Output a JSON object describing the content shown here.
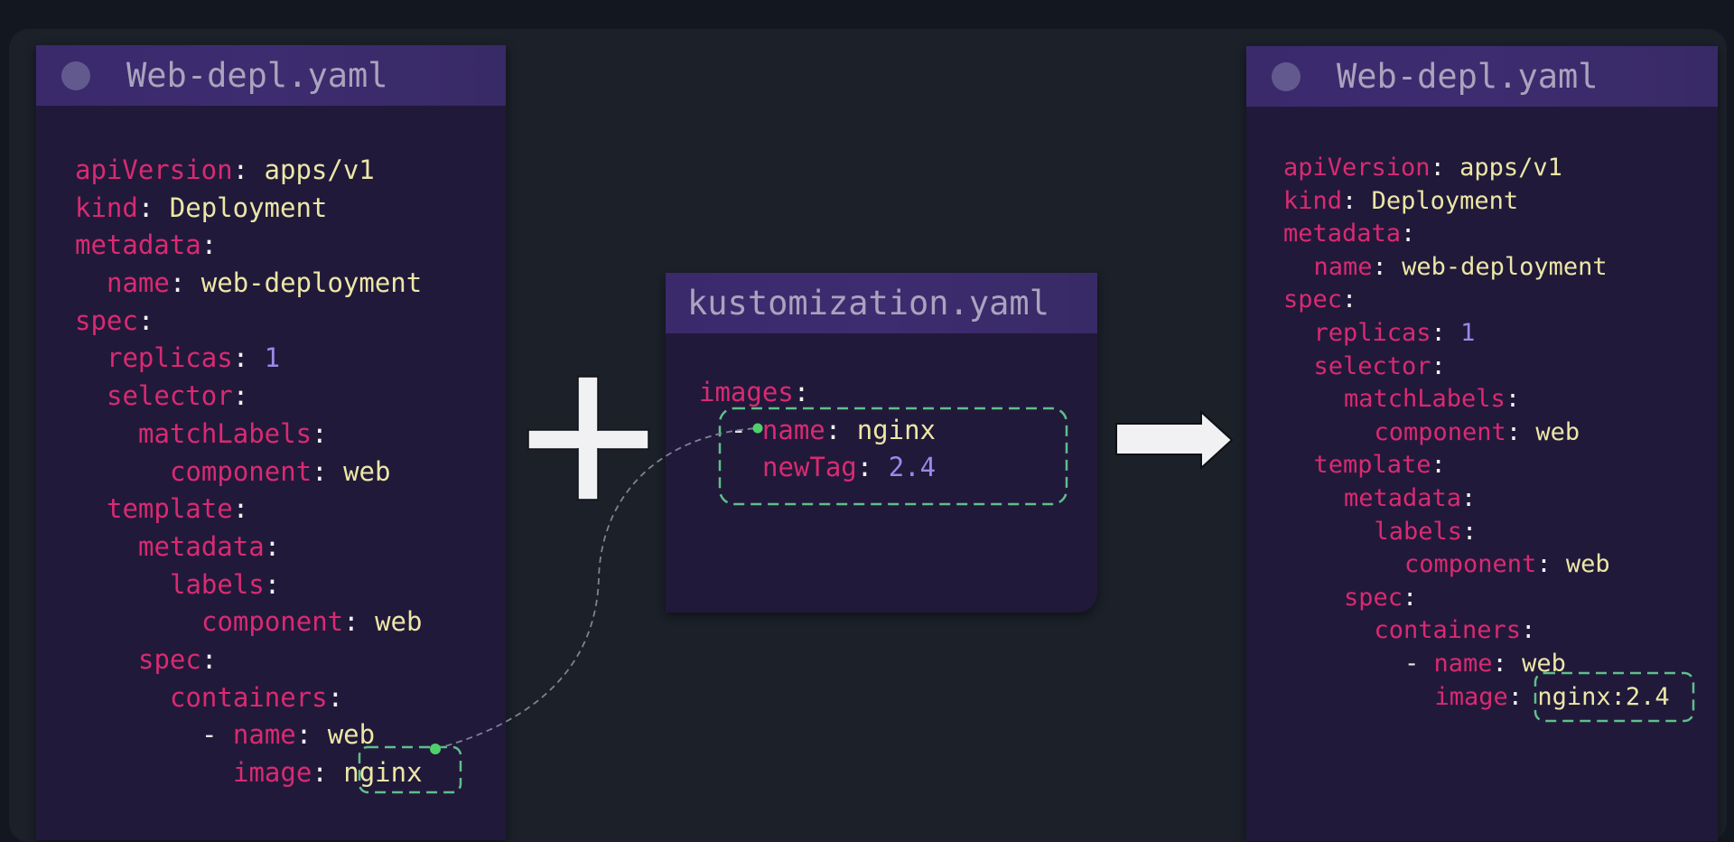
{
  "source_file": {
    "title": "Web-depl.yaml",
    "lines": [
      {
        "indent": 0,
        "key": "apiVersion",
        "value": "apps/v1",
        "type": "string"
      },
      {
        "indent": 0,
        "key": "kind",
        "value": "Deployment",
        "type": "string"
      },
      {
        "indent": 0,
        "key": "metadata",
        "value": "",
        "type": "map"
      },
      {
        "indent": 1,
        "key": "name",
        "value": "web-deployment",
        "type": "string"
      },
      {
        "indent": 0,
        "key": "spec",
        "value": "",
        "type": "map"
      },
      {
        "indent": 1,
        "key": "replicas",
        "value": "1",
        "type": "number"
      },
      {
        "indent": 1,
        "key": "selector",
        "value": "",
        "type": "map"
      },
      {
        "indent": 2,
        "key": "matchLabels",
        "value": "",
        "type": "map"
      },
      {
        "indent": 3,
        "key": "component",
        "value": "web",
        "type": "string"
      },
      {
        "indent": 1,
        "key": "template",
        "value": "",
        "type": "map"
      },
      {
        "indent": 2,
        "key": "metadata",
        "value": "",
        "type": "map"
      },
      {
        "indent": 3,
        "key": "labels",
        "value": "",
        "type": "map"
      },
      {
        "indent": 4,
        "key": "component",
        "value": "web",
        "type": "string"
      },
      {
        "indent": 2,
        "key": "spec",
        "value": "",
        "type": "map"
      },
      {
        "indent": 3,
        "key": "containers",
        "value": "",
        "type": "map"
      },
      {
        "indent": 4,
        "dash": true,
        "key": "name",
        "value": "web",
        "type": "string"
      },
      {
        "indent": 5,
        "key": "image",
        "value": "nginx",
        "type": "string",
        "highlight": true
      }
    ]
  },
  "kustomization": {
    "title": "kustomization.yaml",
    "lines": [
      {
        "indent": 0,
        "key": "images",
        "value": "",
        "type": "map"
      },
      {
        "indent": 1,
        "dash": true,
        "key": "name",
        "value": "nginx",
        "type": "string"
      },
      {
        "indent": 2,
        "key": "newTag",
        "value": "2.4",
        "type": "number"
      }
    ]
  },
  "result_file": {
    "title": "Web-depl.yaml",
    "lines": [
      {
        "indent": 0,
        "key": "apiVersion",
        "value": "apps/v1",
        "type": "string"
      },
      {
        "indent": 0,
        "key": "kind",
        "value": "Deployment",
        "type": "string"
      },
      {
        "indent": 0,
        "key": "metadata",
        "value": "",
        "type": "map"
      },
      {
        "indent": 1,
        "key": "name",
        "value": "web-deployment",
        "type": "string"
      },
      {
        "indent": 0,
        "key": "spec",
        "value": "",
        "type": "map"
      },
      {
        "indent": 1,
        "key": "replicas",
        "value": "1",
        "type": "number"
      },
      {
        "indent": 1,
        "key": "selector",
        "value": "",
        "type": "map"
      },
      {
        "indent": 2,
        "key": "matchLabels",
        "value": "",
        "type": "map"
      },
      {
        "indent": 3,
        "key": "component",
        "value": "web",
        "type": "string"
      },
      {
        "indent": 1,
        "key": "template",
        "value": "",
        "type": "map"
      },
      {
        "indent": 2,
        "key": "metadata",
        "value": "",
        "type": "map"
      },
      {
        "indent": 3,
        "key": "labels",
        "value": "",
        "type": "map"
      },
      {
        "indent": 4,
        "key": "component",
        "value": "web",
        "type": "string"
      },
      {
        "indent": 2,
        "key": "spec",
        "value": "",
        "type": "map"
      },
      {
        "indent": 3,
        "key": "containers",
        "value": "",
        "type": "map"
      },
      {
        "indent": 4,
        "dash": true,
        "key": "name",
        "value": "web",
        "type": "string"
      },
      {
        "indent": 5,
        "key": "image",
        "value": "nginx:2.4",
        "type": "string",
        "highlight": true
      }
    ]
  },
  "operators": {
    "plus": "plus-icon",
    "arrow": "arrow-right-icon"
  },
  "colors": {
    "key": "#d92a72",
    "string": "#ece7a6",
    "number": "#9c88e8",
    "highlight_border": "#5fbf8a",
    "connector_dot": "#4fd06a",
    "connector_line": "#7c8494"
  }
}
